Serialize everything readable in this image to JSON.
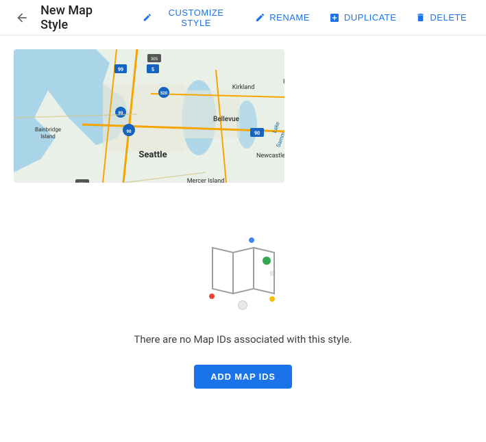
{
  "header": {
    "title": "New Map Style",
    "back_icon": "←",
    "actions": [
      {
        "id": "customize",
        "label": "CUSTOMIZE STYLE",
        "icon": "✏"
      },
      {
        "id": "rename",
        "label": "RENAME",
        "icon": "✏"
      },
      {
        "id": "duplicate",
        "label": "DUPLICATE",
        "icon": "⧉"
      },
      {
        "id": "delete",
        "label": "DELETE",
        "icon": "🗑"
      }
    ]
  },
  "main": {
    "empty_state_text": "There are no Map IDs associated with this style.",
    "add_button_label": "ADD MAP IDS"
  },
  "colors": {
    "blue": "#1a73e8",
    "green": "#34a853",
    "red": "#ea4335",
    "yellow": "#fbbc04",
    "light_blue": "#b3d9f5",
    "map_water": "#a8cce0",
    "map_land": "#e8f5e0",
    "map_road": "#f5a623",
    "map_urban": "#f0f0e8"
  }
}
